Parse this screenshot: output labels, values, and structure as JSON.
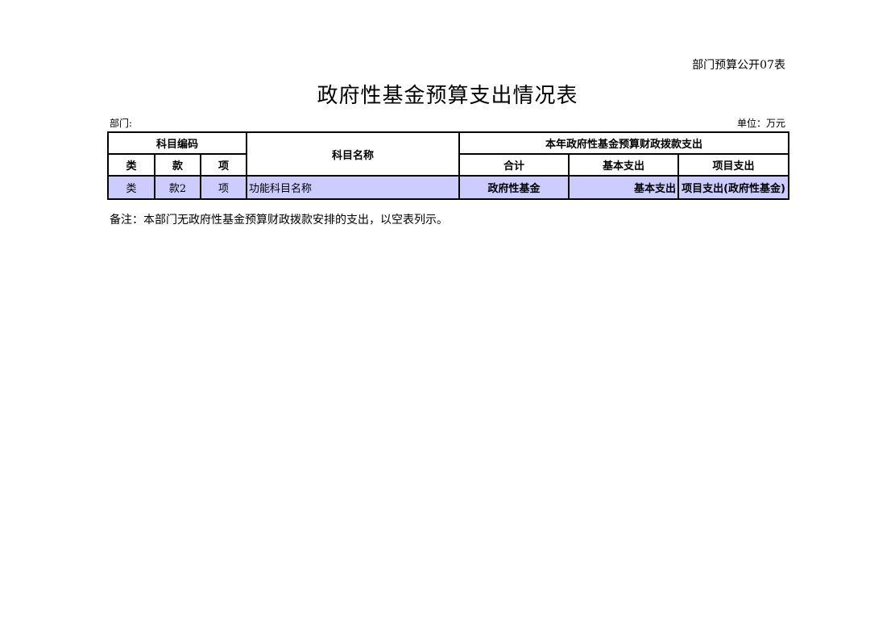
{
  "header": {
    "doc_number": "部门预算公开07表",
    "title": "政府性基金预算支出情况表",
    "department_label": "部门:",
    "unit_label": "单位：万元"
  },
  "table": {
    "group_code": "科目编码",
    "col_name": "科目名称",
    "group_expend": "本年政府性基金预算财政拨款支出",
    "col_class": "类",
    "col_kuan": "款",
    "col_item": "项",
    "col_total": "合计",
    "col_basic": "基本支出",
    "col_project": "项目支出",
    "row": {
      "class": "类",
      "kuan": "款2",
      "item": "项",
      "name": "功能科目名称",
      "total": "政府性基金",
      "basic": "基本支出",
      "project": "项目支出(政府性基金)"
    }
  },
  "footer": {
    "note": "备注：本部门无政府性基金预算财政拨款安排的支出，以空表列示。"
  }
}
